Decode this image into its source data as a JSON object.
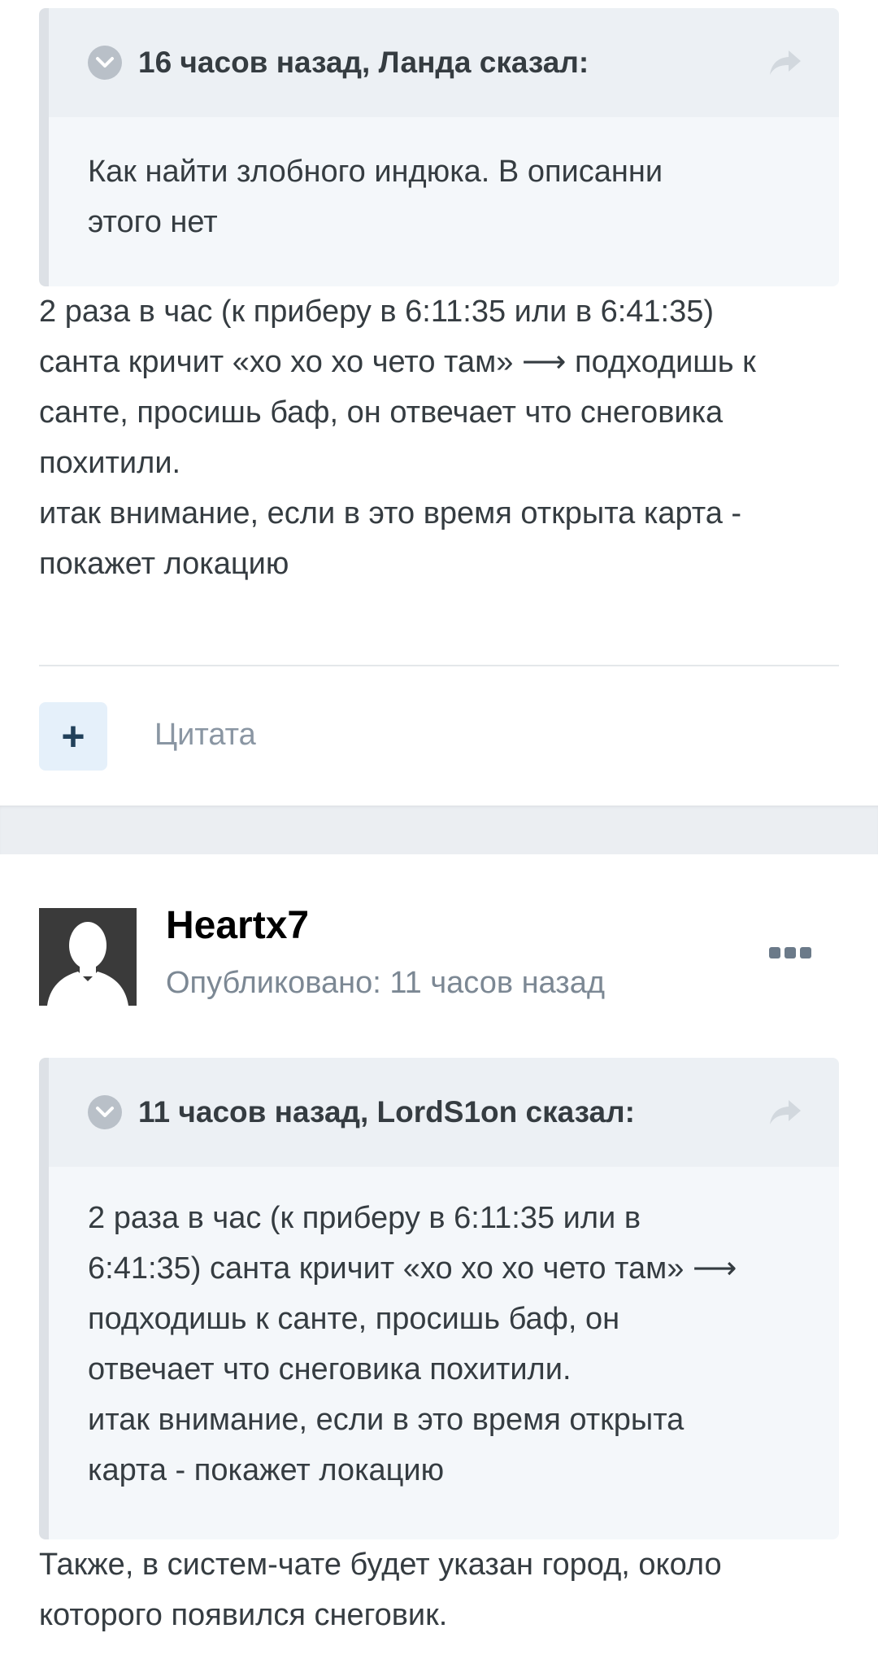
{
  "post1": {
    "quote": {
      "citation": "16 часов назад, Ланда сказал:",
      "text": "Как найти злобного индюка. В описанни этого  нет"
    },
    "lines": [
      "2 раза в час (к приберу в 6:11:35 или в 6:41:35)",
      "санта кричит «хо хо хо чето там» ⟶ подходишь к",
      "санте, просишь баф, он отвечает что снеговика",
      "похитили.",
      "итак внимание, если в это время открыта карта -",
      "покажет локацию"
    ],
    "quote_button_icon": "+",
    "quote_label": "Цитата"
  },
  "post2": {
    "author": "Heartx7",
    "posted": "Опубликовано: 11 часов назад",
    "quote": {
      "citation": "11 часов назад, LordS1on сказал:",
      "lines": [
        "2 раза в час (к приберу в 6:11:35 или в",
        "6:41:35) санта кричит «хо хо хо чето там» ⟶",
        "подходишь к санте, просишь баф, он",
        "отвечает что снеговика похитили.",
        "итак внимание, если в это время открыта",
        "карта - покажет локацию"
      ]
    },
    "lines": [
      "Также, в систем-чате будет указан город, около",
      "которого появился снеговик."
    ]
  },
  "icons": {
    "toggle": "chevron-down-icon",
    "share": "share-arrow-icon",
    "more": "more-options-icon",
    "avatar": "default-avatar-silhouette"
  },
  "colors": {
    "quote_bg": "#f4f7fa",
    "quote_header_bg": "#ecf0f4",
    "quote_border": "#dde1e6",
    "quote_button_bg": "#e5f0fa",
    "text": "#353c41",
    "muted": "#7c8894"
  }
}
